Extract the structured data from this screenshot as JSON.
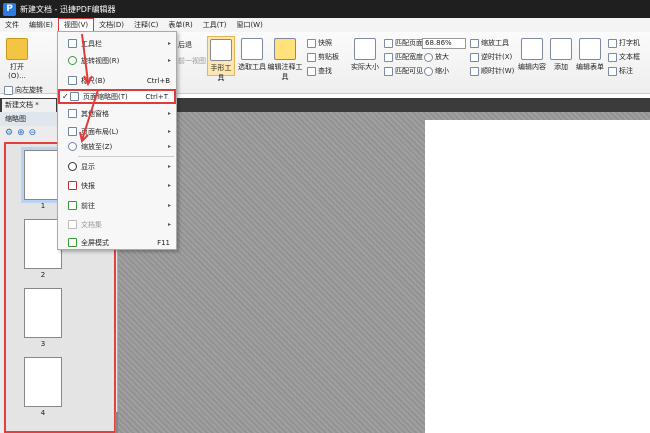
{
  "window": {
    "title": "新建文档 - 迅捷PDF编辑器",
    "logo": "P"
  },
  "menubar": [
    "文件",
    "编辑(E)",
    "视图(V)",
    "文档(D)",
    "注释(C)",
    "表单(R)",
    "工具(T)",
    "窗口(W)"
  ],
  "ribbon": {
    "open": "打开(O)...",
    "back": "后退",
    "prev_view": "前一视图",
    "hand_tool": "手形工具",
    "select_tool": "选取工具",
    "edit_annot_tool": "编辑注释工具",
    "snapshot": "快照",
    "clipboard": "剪贴板",
    "find": "查找",
    "actual_size": "实际大小",
    "fit_page": "匹配页面",
    "fit_width": "匹配宽度",
    "fit_visible": "匹配可见",
    "zoom_value": "68.86%",
    "zoom_tool": "缩放工具",
    "zoom_in": "放大",
    "zoom_out": "缩小",
    "rotate_ccw": "逆时针(X)",
    "rotate_cw": "顺时针(W)",
    "edit_content": "编辑内容",
    "add": "添加",
    "edit_form": "编辑表单",
    "typewriter": "打字机",
    "textbox": "文本框",
    "annotate": "标注"
  },
  "toolbar2": {
    "rotate_left": "向左旋转"
  },
  "tabs": [
    "新建文档 *"
  ],
  "thumb_panel": {
    "title": "缩略图",
    "page_numbers": [
      "1",
      "2",
      "3",
      "4"
    ]
  },
  "view_menu": {
    "items": [
      {
        "label": "工具栏",
        "shortcut": "",
        "submenu": true
      },
      {
        "label": "旋转视图(R)",
        "shortcut": "",
        "submenu": true
      },
      {
        "label": "标尺(B)",
        "shortcut": "Ctrl+B",
        "submenu": false
      },
      {
        "label": "页面缩略图(T)",
        "shortcut": "Ctrl+T",
        "submenu": false,
        "checked": true,
        "highlight": true
      },
      {
        "label": "其他窗格",
        "shortcut": "",
        "submenu": true
      },
      {
        "label": "页面布局(L)",
        "shortcut": "",
        "submenu": true
      },
      {
        "label": "缩放至(Z)",
        "shortcut": "",
        "submenu": true
      },
      {
        "label": "显示",
        "shortcut": "",
        "submenu": true
      },
      {
        "label": "快报",
        "shortcut": "",
        "submenu": true
      },
      {
        "label": "前往",
        "shortcut": "",
        "submenu": true
      },
      {
        "label": "文档集",
        "shortcut": "",
        "submenu": true,
        "disabled": true
      },
      {
        "label": "全屏模式",
        "shortcut": "F11",
        "submenu": false
      }
    ],
    "checkmark": "✓",
    "arrow_glyph": "▸"
  },
  "colors": {
    "highlight_red": "#e03a3a",
    "title_bg": "#1f1f1f",
    "canvas_bg": "#9a9a9a"
  }
}
